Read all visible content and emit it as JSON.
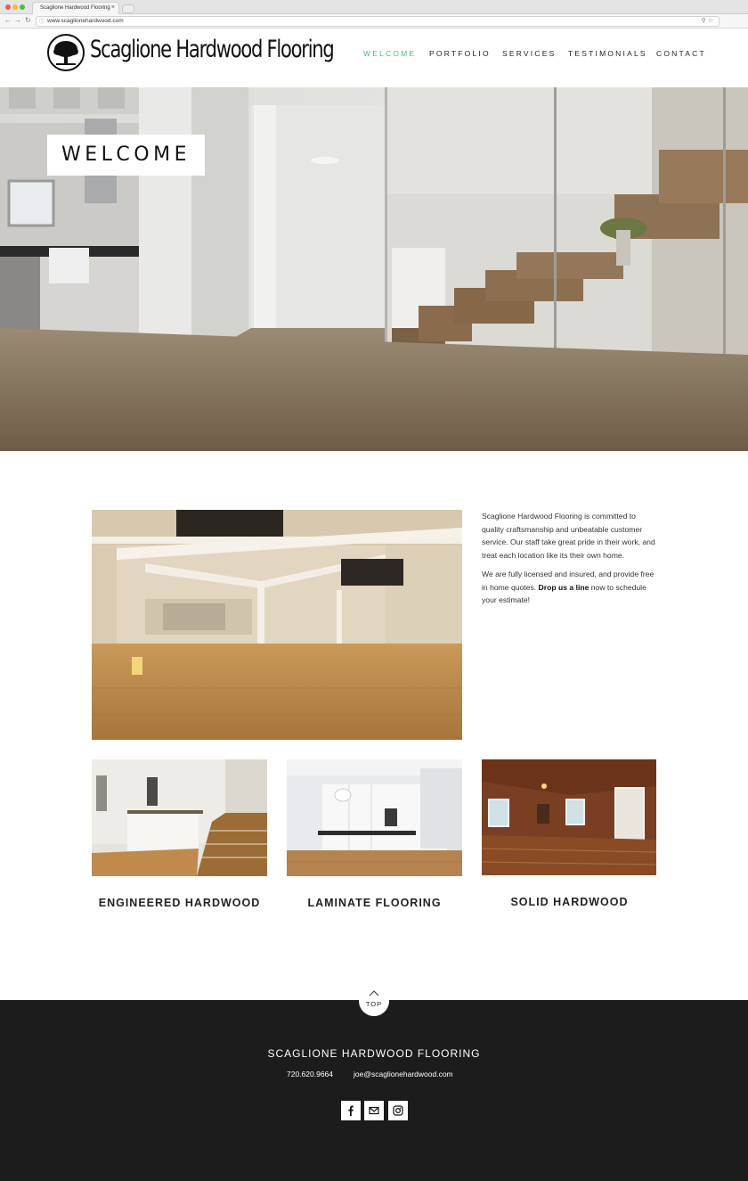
{
  "browser": {
    "tab_title": "Scaglione Hardwood Flooring",
    "tab_close": "×",
    "url": "www.scaglionehardwood.com"
  },
  "header": {
    "logo_text": "Scaglione Hardwood Flooring",
    "nav": [
      {
        "label": "WELCOME",
        "active": true
      },
      {
        "label": "PORTFOLIO",
        "active": false
      },
      {
        "label": "SERVICES",
        "active": false
      },
      {
        "label": "TESTIMONIALS",
        "active": false
      },
      {
        "label": "CONTACT",
        "active": false
      }
    ]
  },
  "hero": {
    "title": "WELCOME"
  },
  "intro": {
    "paragraph1": "Scaglione Hardwood Flooring is committed to quality craftsmanship and unbeatable customer service. Our staff take great pride in their work, and treat each location like its their own home.",
    "paragraph2_before": "We are fully licensed and insured, and provide free in home quotes. ",
    "paragraph2_link": "Drop us a line",
    "paragraph2_after": " now to schedule your estimate!"
  },
  "products": [
    {
      "title": "ENGINEERED HARDWOOD"
    },
    {
      "title": "LAMINATE FLOORING"
    },
    {
      "title": "SOLID HARDWOOD"
    }
  ],
  "footer": {
    "top_label": "TOP",
    "company": "SCAGLIONE HARDWOOD FLOORING",
    "phone": "720.620.9664",
    "email": "joe@scaglionehardwood.com",
    "social_icons": [
      "facebook-icon",
      "email-icon",
      "instagram-icon"
    ]
  },
  "colors": {
    "nav_active": "#46b97c",
    "footer_bg": "#1c1c1c"
  }
}
